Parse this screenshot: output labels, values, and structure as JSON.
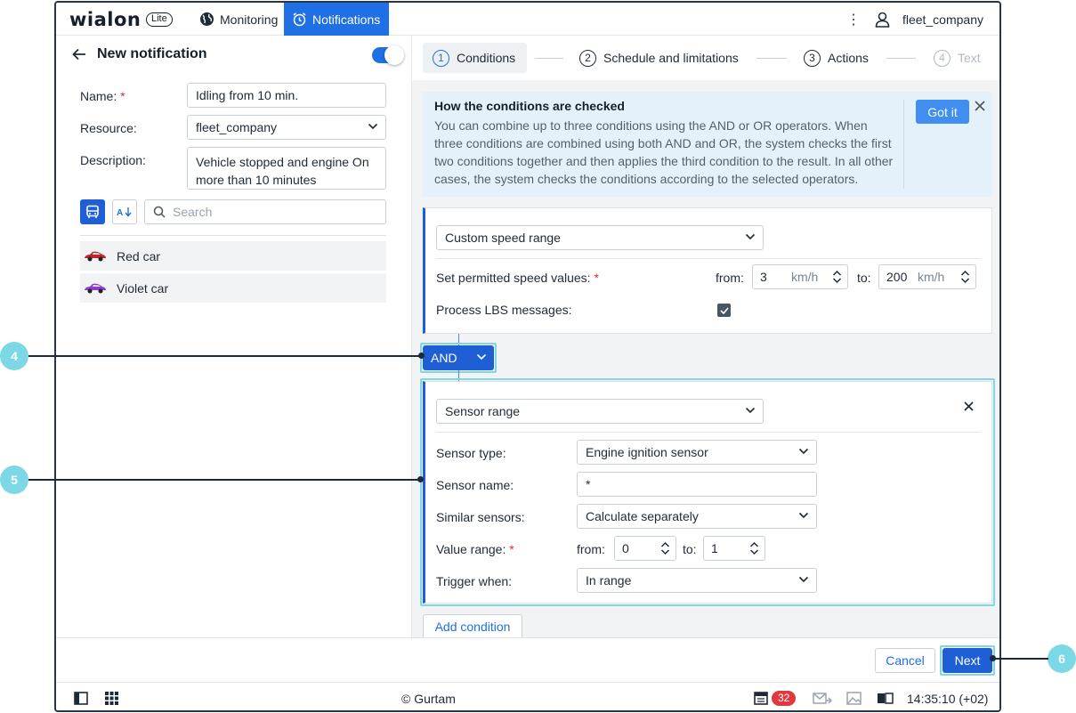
{
  "topbar": {
    "logo": "wialon",
    "logo_badge": "Lite",
    "nav": [
      {
        "label": "Monitoring",
        "icon": "globe-icon"
      },
      {
        "label": "Notifications",
        "icon": "alarm-clock-icon",
        "active": true
      }
    ],
    "username": "fleet_company"
  },
  "left_panel": {
    "title": "New notification",
    "enabled": true,
    "name_label": "Name:",
    "name_value": "Idling from 10 min.",
    "resource_label": "Resource:",
    "resource_value": "fleet_company",
    "description_label": "Description:",
    "description_value": "Vehicle stopped and engine On more than 10 minutes",
    "search_placeholder": "Search",
    "units": [
      {
        "name": "Red car",
        "icon": "red-car-icon",
        "color": "#c0242c"
      },
      {
        "name": "Violet car",
        "icon": "violet-car-icon",
        "color": "#8b3fc9"
      }
    ]
  },
  "steps": [
    {
      "num": "1",
      "label": "Conditions",
      "state": "active"
    },
    {
      "num": "2",
      "label": "Schedule and limitations",
      "state": "default"
    },
    {
      "num": "3",
      "label": "Actions",
      "state": "default"
    },
    {
      "num": "4",
      "label": "Text",
      "state": "disabled"
    }
  ],
  "info": {
    "title": "How the conditions are checked",
    "text": "You can combine up to three conditions using the AND or OR operators. When three conditions are combined using both AND and OR, the system checks the first two conditions together and then applies the third condition to the result. In all other cases, the system checks the conditions according to the selected operators.",
    "button": "Got it"
  },
  "condition1": {
    "type": "Custom speed range",
    "speed_label": "Set permitted speed values:",
    "from_label": "from:",
    "from_value": "3",
    "to_label": "to:",
    "to_value": "200",
    "unit": "km/h",
    "lbs_label": "Process LBS messages:",
    "lbs_checked": true
  },
  "operator": "AND",
  "condition2": {
    "type": "Sensor range",
    "sensor_type_label": "Sensor type:",
    "sensor_type_value": "Engine ignition sensor",
    "sensor_name_label": "Sensor name:",
    "sensor_name_value": "*",
    "similar_label": "Similar sensors:",
    "similar_value": "Calculate separately",
    "range_label": "Value range:",
    "from_label": "from:",
    "from_value": "0",
    "to_label": "to:",
    "to_value": "1",
    "trigger_label": "Trigger when:",
    "trigger_value": "In range"
  },
  "add_condition": "Add condition",
  "footer": {
    "cancel": "Cancel",
    "next": "Next"
  },
  "statusbar": {
    "copyright": "© Gurtam",
    "events_count": "32",
    "time": "14:35:10 (+02)"
  },
  "callouts": [
    "4",
    "5",
    "6"
  ],
  "colors": {
    "accent": "#1f6fe5",
    "highlight": "#7fd6e4",
    "info_bg": "#e4f1fb",
    "badge": "#e0383e"
  }
}
